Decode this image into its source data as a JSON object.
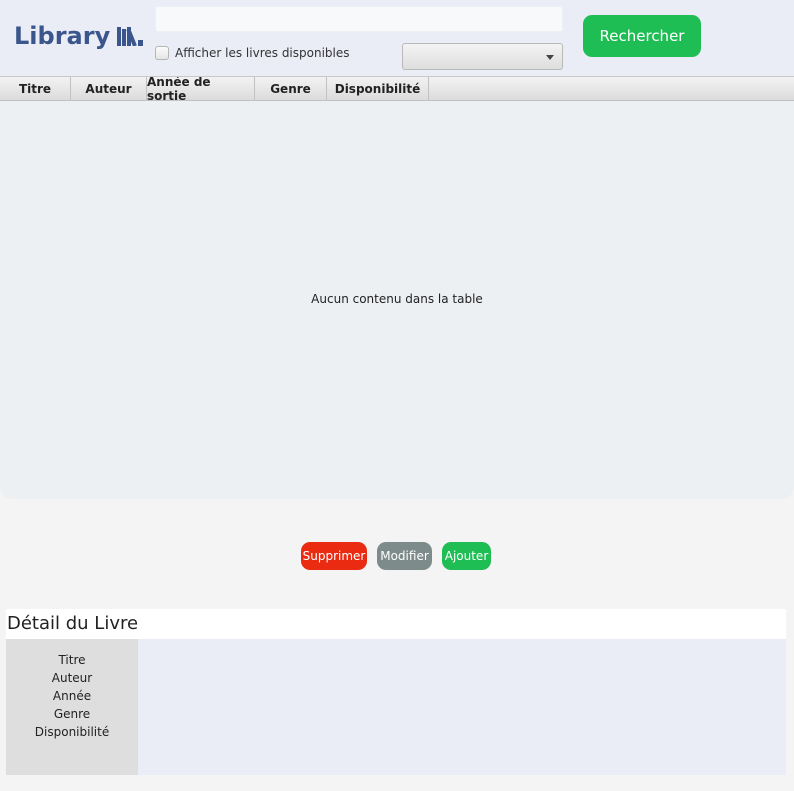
{
  "header": {
    "logo_text": "Library",
    "logo_icon": "books-icon",
    "search": {
      "value": "",
      "placeholder": ""
    },
    "available_checkbox": {
      "label": "Afficher les livres disponibles",
      "checked": false
    },
    "genre_select": {
      "selected": ""
    },
    "search_button_label": "Rechercher"
  },
  "table": {
    "columns": [
      "Titre",
      "Auteur",
      "Année de sortie",
      "Genre",
      "Disponibilité"
    ],
    "rows": [],
    "empty_message": "Aucun contenu dans la table"
  },
  "actions": {
    "delete_label": "Supprimer",
    "edit_label": "Modifier",
    "add_label": "Ajouter"
  },
  "detail": {
    "title": "Détail du Livre",
    "labels": [
      "Titre",
      "Auteur",
      "Année",
      "Genre",
      "Disponibilité"
    ]
  },
  "colors": {
    "brand": "#3b568c",
    "success": "#1fbe54",
    "danger": "#ea2b12",
    "neutral": "#7e8b8b"
  }
}
